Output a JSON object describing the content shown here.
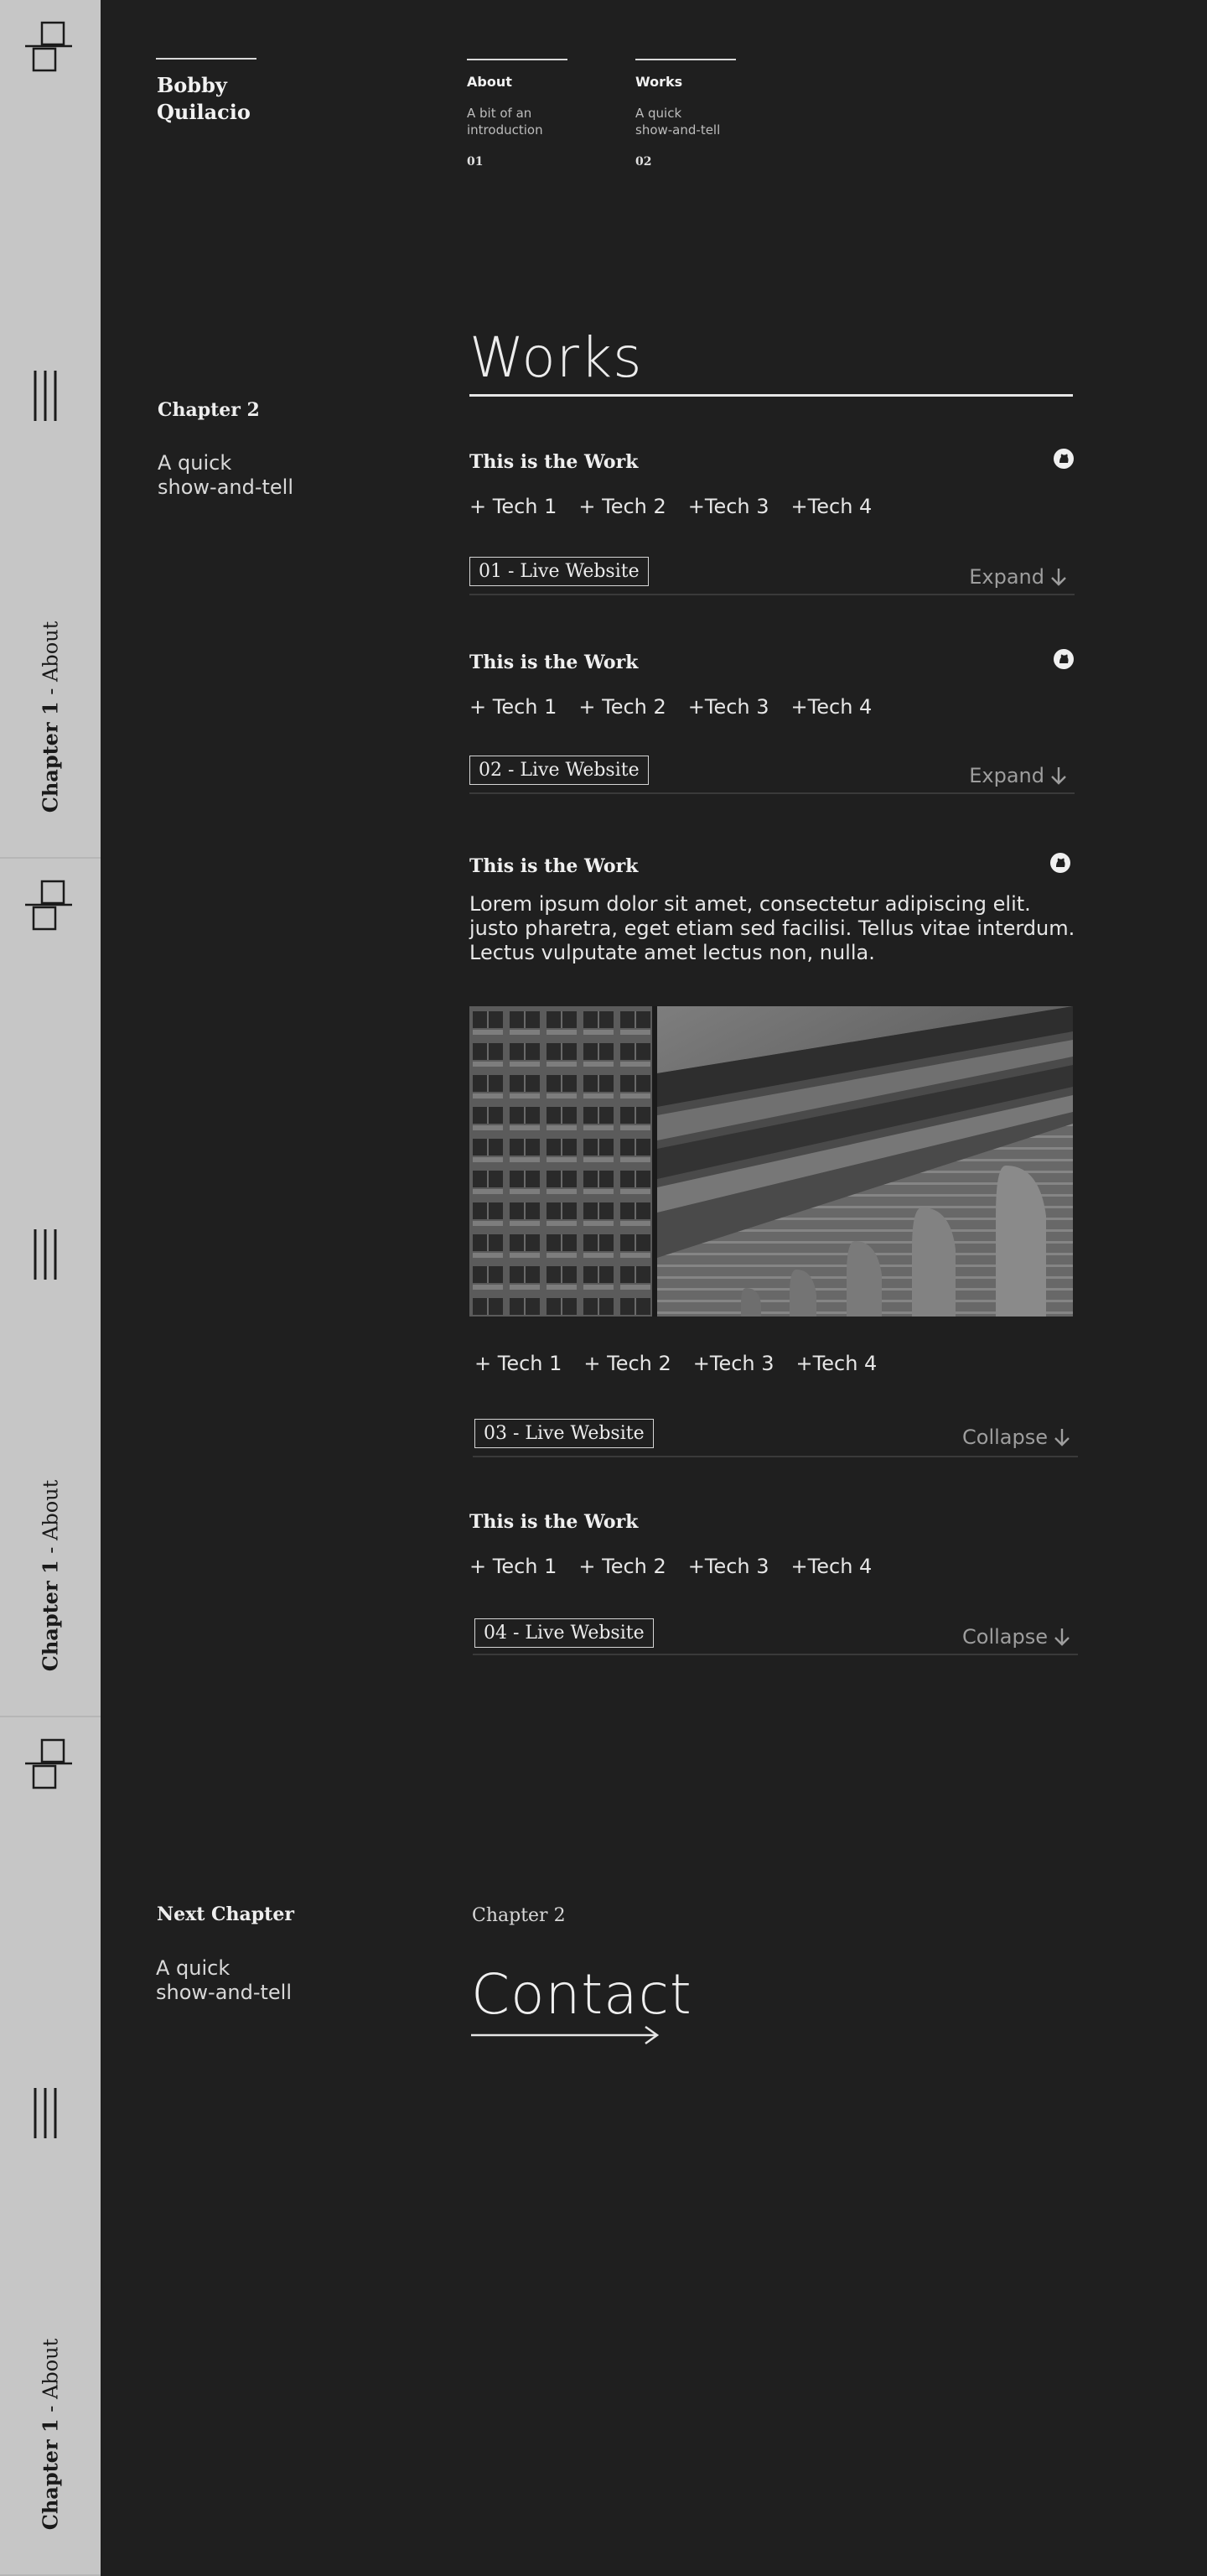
{
  "rail": {
    "chapter_bold": "Chapter 1",
    "chapter_rest": " - About"
  },
  "brand": {
    "name_line1": "Bobby",
    "name_line2": "Quilacio"
  },
  "nav": [
    {
      "title": "About",
      "desc_line1": "A bit of an",
      "desc_line2": "introduction",
      "num": "01"
    },
    {
      "title": "Works",
      "desc_line1": "A quick",
      "desc_line2": "show-and-tell",
      "num": "02"
    }
  ],
  "section": {
    "side_title": "Chapter 2",
    "side_desc_line1": "A quick",
    "side_desc_line2": "show-and-tell",
    "heading": "Works"
  },
  "works": [
    {
      "title": "This is the Work",
      "techs": [
        "+ Tech 1",
        "+ Tech 2",
        "+Tech 3",
        "+Tech 4"
      ],
      "live": "01 - Live Website",
      "toggle": "Expand",
      "github_icon": "github-icon"
    },
    {
      "title": "This is the Work",
      "techs": [
        "+ Tech 1",
        "+ Tech 2",
        "+Tech 3",
        "+Tech 4"
      ],
      "live": "02 - Live Website",
      "toggle": "Expand",
      "github_icon": "github-icon"
    },
    {
      "title": "This is the Work",
      "description_lines": [
        "Lorem ipsum dolor sit amet, consectetur adipiscing elit.",
        "justo pharetra, eget etiam sed facilisi. Tellus vitae interdum.",
        "Lectus vulputate amet lectus non, nulla."
      ],
      "techs": [
        "+ Tech 1",
        "+ Tech 2",
        "+Tech 3",
        "+Tech 4"
      ],
      "live": "03 - Live Website",
      "toggle": "Collapse",
      "github_icon": "github-icon"
    },
    {
      "title": "This is the Work",
      "techs": [
        "+ Tech 1",
        "+ Tech 2",
        "+Tech 3",
        "+Tech 4"
      ],
      "live": "04 - Live Website",
      "toggle": "Collapse"
    }
  ],
  "next": {
    "title": "Next Chapter",
    "desc_line1": "A quick",
    "desc_line2": "show-and-tell",
    "chapter": "Chapter 2",
    "link": "Contact"
  },
  "colors": {
    "background": "#1f1f1f",
    "rail": "#c6c6c6",
    "text": "#e8e8e8",
    "muted": "#9e9e9e"
  }
}
